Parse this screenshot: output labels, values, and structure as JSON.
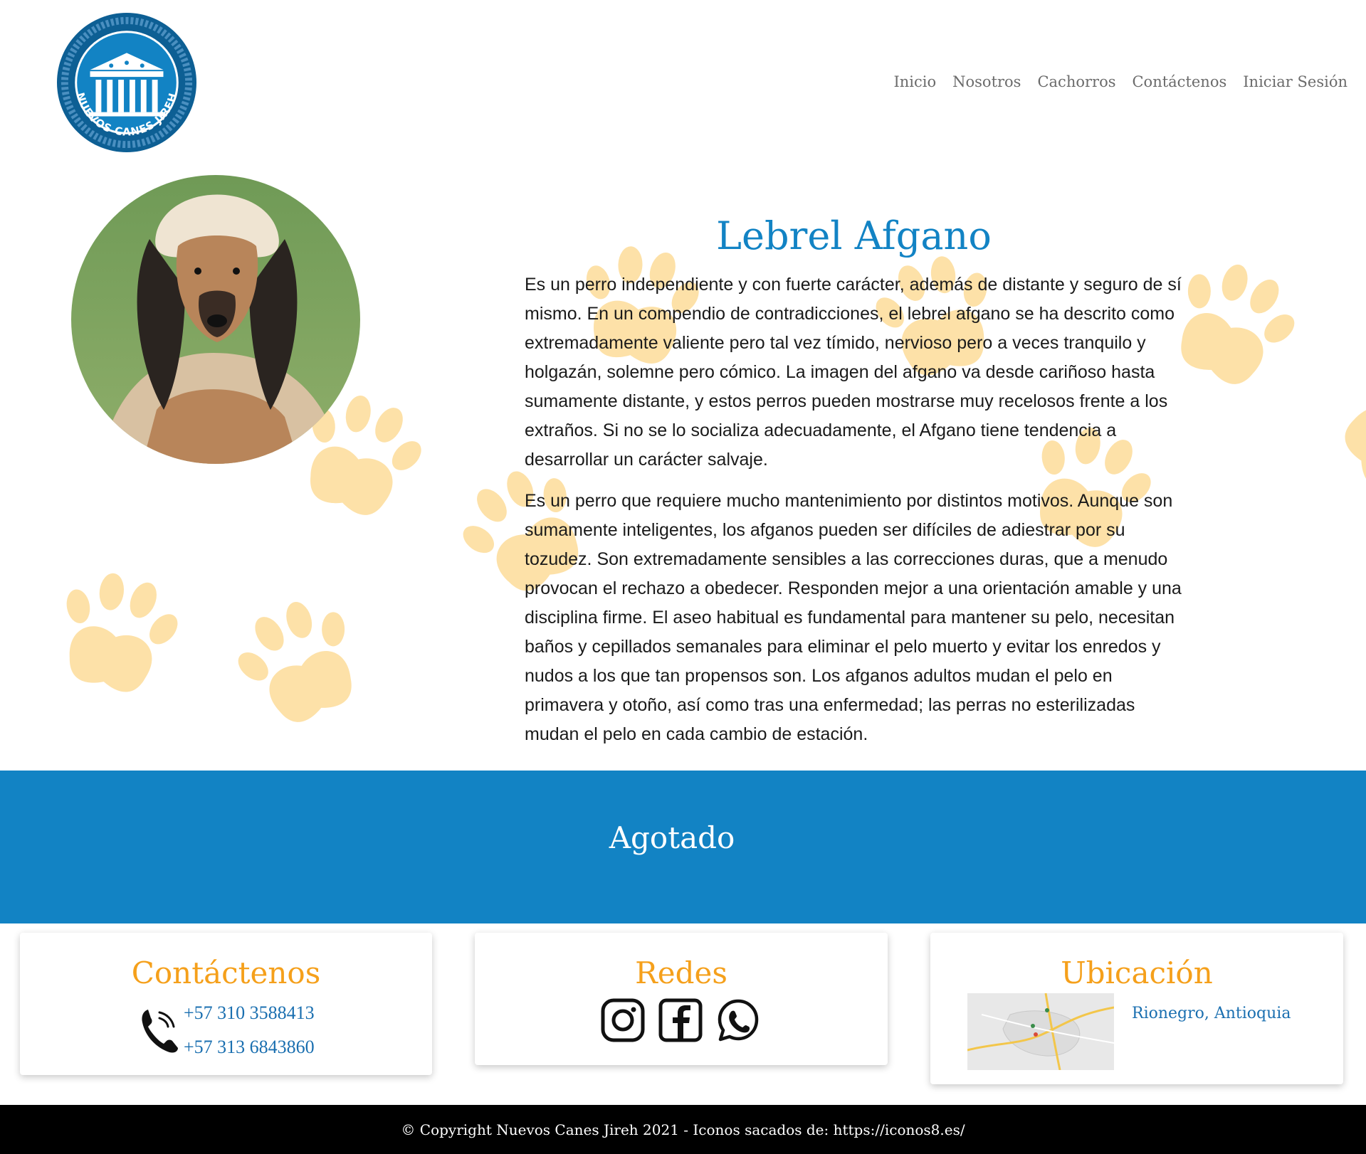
{
  "brand": {
    "logo_text": "NUEVOS CANES JIREH"
  },
  "nav": {
    "items": [
      {
        "label": "Inicio"
      },
      {
        "label": "Nosotros"
      },
      {
        "label": "Cachorros"
      },
      {
        "label": "Contáctenos"
      },
      {
        "label": "Iniciar Sesión"
      }
    ]
  },
  "breed": {
    "title": "Lebrel Afgano",
    "paragraphs": [
      "Es un perro independiente y con fuerte carácter, además de distante y seguro de sí mismo. En un compendio de contradicciones, el lebrel afgano se ha descrito como extremadamente valiente pero tal vez tímido, nervioso pero a veces tranquilo y holgazán, solemne pero cómico. La imagen del afgano va desde cariñoso hasta sumamente distante, y estos perros pueden mostrarse muy recelosos frente a los extraños. Si no se lo socializa adecuadamente, el Afgano tiene tendencia a desarrollar un carácter salvaje.",
      "Es un perro que requiere mucho mantenimiento por distintos motivos. Aunque son sumamente inteligentes, los afganos pueden ser difíciles de adiestrar por su tozudez. Son extremadamente sensibles a las correcciones duras, que a menudo provocan el rechazo a obedecer. Responden mejor a una orientación amable y una disciplina firme. El aseo habitual es fundamental para mantener su pelo, necesitan baños y cepillados semanales para eliminar el pelo muerto y evitar los enredos y nudos a los que tan propensos son. Los afganos adultos mudan el pelo en primavera y otoño, así como tras una enfermedad; las perras no esterilizadas mudan el pelo en cada cambio de estación."
    ]
  },
  "status": {
    "label": "Agotado"
  },
  "footer": {
    "contact": {
      "title": "Contáctenos",
      "phones": [
        "+57 310 3588413",
        "+57 313 6843860"
      ],
      "icon": "phone-icon"
    },
    "social": {
      "title": "Redes",
      "icons": [
        "instagram-icon",
        "facebook-icon",
        "whatsapp-icon"
      ]
    },
    "location": {
      "title": "Ubicación",
      "place": "Rionegro, Antioquia"
    },
    "copyright": "© Copyright Nuevos Canes Jireh 2021 - Iconos sacados de: https://iconos8.es/"
  },
  "colors": {
    "brand_blue": "#1283c4",
    "accent_orange": "#f5a01b",
    "paw": "#fde1a8",
    "link_blue": "#1a6fb0"
  }
}
